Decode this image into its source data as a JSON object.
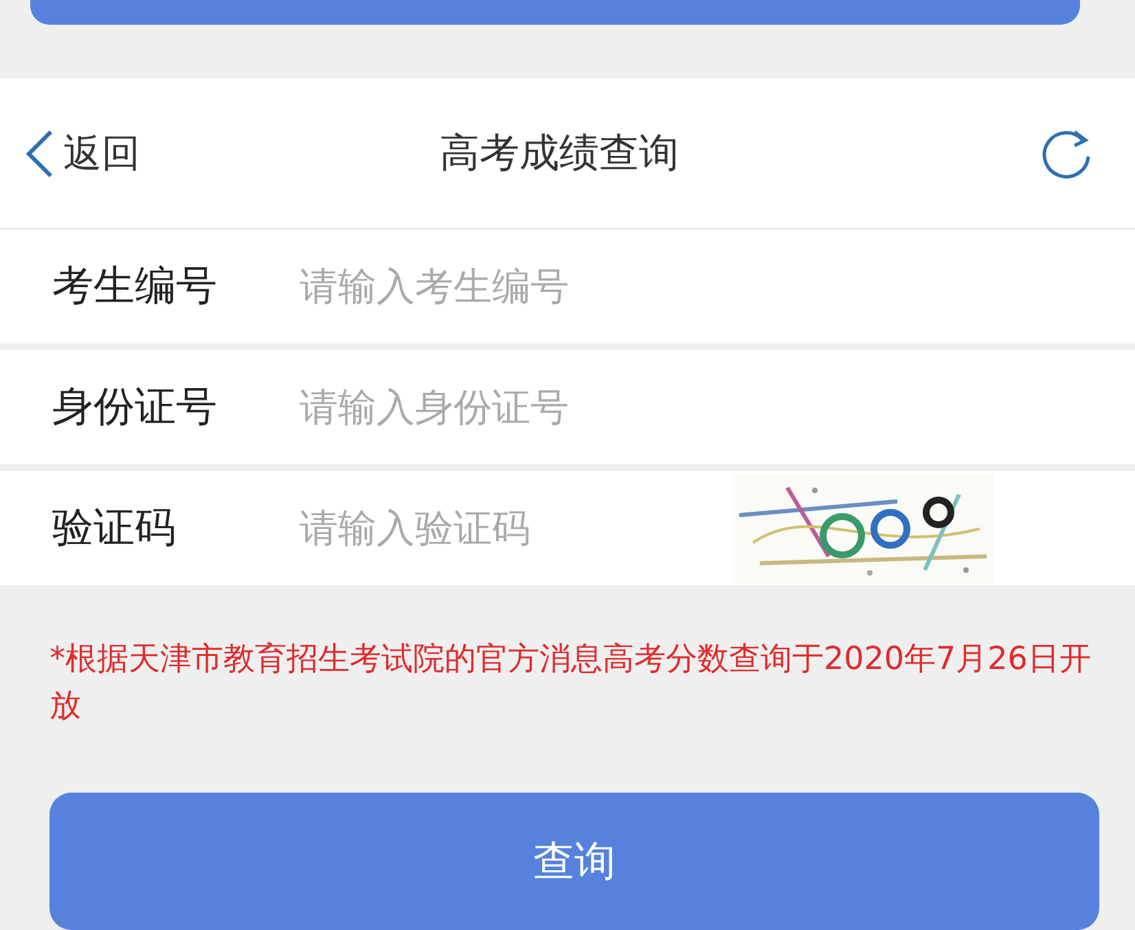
{
  "header": {
    "back_label": "返回",
    "title": "高考成绩查询"
  },
  "fields": [
    {
      "label": "考生编号",
      "placeholder": "请输入考生编号",
      "kind": "text"
    },
    {
      "label": "身份证号",
      "placeholder": "请输入身份证号",
      "kind": "text"
    },
    {
      "label": "验证码",
      "placeholder": "请输入验证码",
      "kind": "captcha"
    }
  ],
  "notice": "*根据天津市教育招生考试院的官方消息高考分数查询于2020年7月26日开放",
  "submit_button": "查询"
}
